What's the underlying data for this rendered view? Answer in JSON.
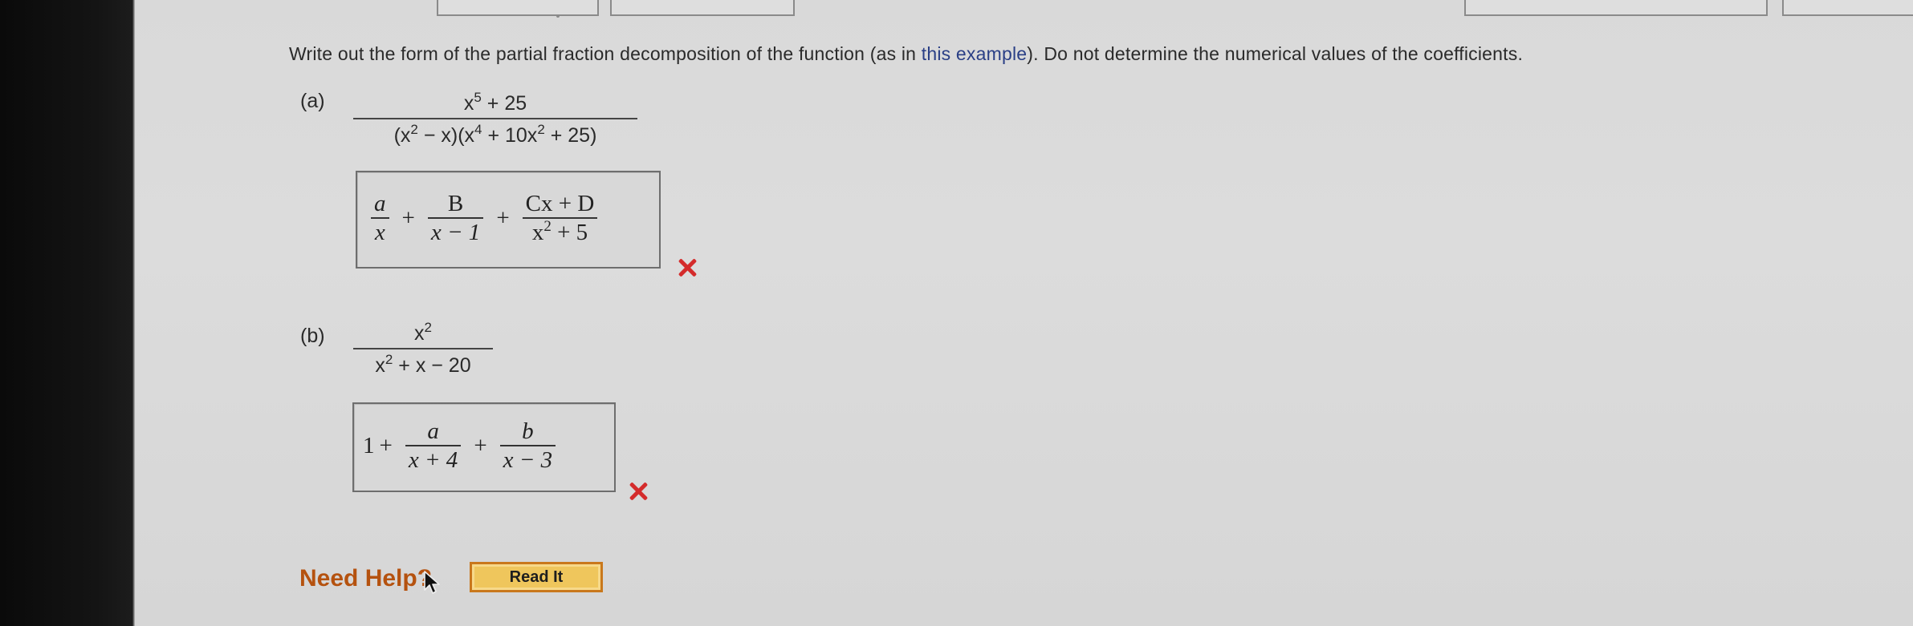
{
  "instructions": {
    "before_link": "Write out the form of the partial fraction decomposition of the function (as in ",
    "link_text": "this example",
    "after_link": "). Do not determine the numerical values of the coefficients."
  },
  "part_a": {
    "label": "(a)",
    "function": {
      "numerator_base": "x",
      "numerator_exp": "5",
      "numerator_rest": " + 25",
      "den_1": "(x",
      "den_1_exp": "2",
      "den_2": " − x)(x",
      "den_2_exp": "4",
      "den_3": " + 10x",
      "den_3_exp": "2",
      "den_4": " + 25)"
    },
    "answer": {
      "t1_num": "a",
      "t1_den": "x",
      "plus1": "+",
      "t2_num": "B",
      "t2_den": "x − 1",
      "plus2": "+",
      "t3_num": "Cx + D",
      "t3_den_base": "x",
      "t3_den_exp": "2",
      "t3_den_rest": " + 5"
    },
    "status": "incorrect"
  },
  "part_b": {
    "label": "(b)",
    "function": {
      "numerator_base": "x",
      "numerator_exp": "2",
      "den_base": "x",
      "den_exp": "2",
      "den_rest": " + x − 20"
    },
    "answer": {
      "lead": "1",
      "plus0": "+",
      "t1_num": "a",
      "t1_den": "x + 4",
      "plus1": "+",
      "t2_num": "b",
      "t2_den": "x − 3"
    },
    "status": "incorrect"
  },
  "help": {
    "need_help_text": "Need Help?",
    "read_it_label": "Read It"
  },
  "colors": {
    "link": "#2a3f86",
    "error_mark": "#d42b2b",
    "need_help": "#b5520f",
    "read_it_bg": "#efc65c"
  }
}
